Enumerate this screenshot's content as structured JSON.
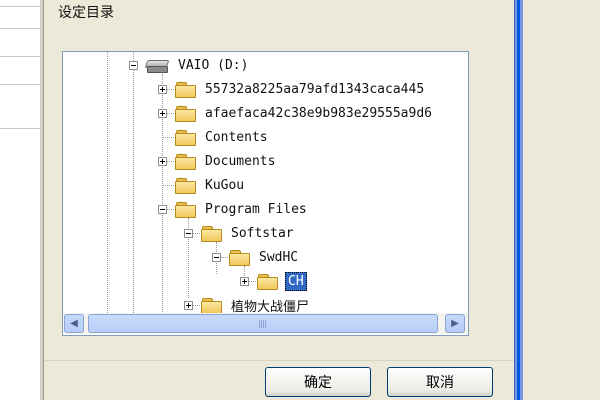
{
  "dialog": {
    "title": "设定目录",
    "ok_label": "确定",
    "cancel_label": "取消"
  },
  "tree": {
    "drive_label": "VAIO (D:)",
    "items": [
      {
        "label": "55732a8225aa79afd1343caca445",
        "expander": "plus",
        "selected": false
      },
      {
        "label": "afaefaca42c38e9b983e29555a9d6",
        "expander": "plus",
        "selected": false
      },
      {
        "label": "Contents",
        "expander": "none",
        "selected": false
      },
      {
        "label": "Documents",
        "expander": "plus",
        "selected": false
      },
      {
        "label": "KuGou",
        "expander": "none",
        "selected": false
      },
      {
        "label": "Program Files",
        "expander": "minus",
        "selected": false
      },
      {
        "label": "Softstar",
        "expander": "minus",
        "selected": false
      },
      {
        "label": "SwdHC",
        "expander": "minus",
        "selected": false
      },
      {
        "label": "CH",
        "expander": "plus",
        "selected": true
      },
      {
        "label": "植物大战僵尸",
        "expander": "plus",
        "selected": false
      }
    ]
  },
  "scrollbars": {
    "up_glyph": "▲",
    "down_glyph": "▼",
    "left_glyph": "◀",
    "right_glyph": "▶"
  },
  "colors": {
    "selection": "#316ac5",
    "folder": "#efc65a",
    "window_frame": "#0054e3"
  }
}
